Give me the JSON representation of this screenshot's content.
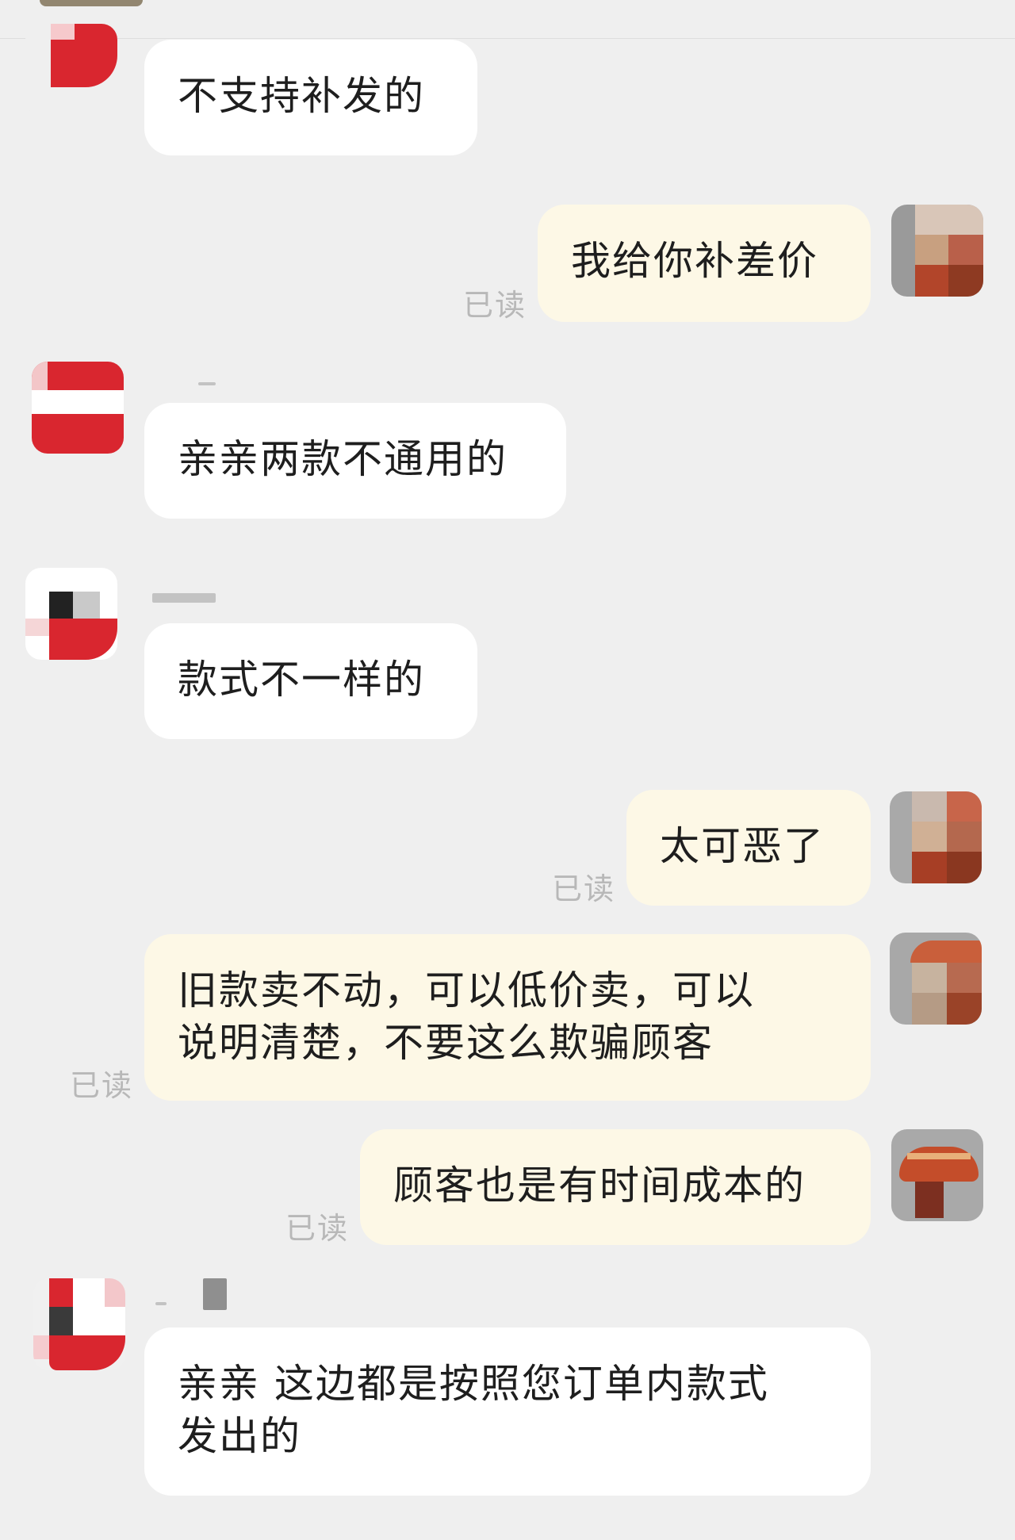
{
  "messages": [
    {
      "dir": "in",
      "text": "不支持补发的"
    },
    {
      "dir": "out",
      "text": "我给你补差价",
      "read": "已读"
    },
    {
      "dir": "in",
      "text": "亲亲两款不通用的"
    },
    {
      "dir": "in",
      "text": "款式不一样的"
    },
    {
      "dir": "out",
      "text": "太可恶了",
      "read": "已读"
    },
    {
      "dir": "out",
      "text": "旧款卖不动，可以低价卖，可以\n说明清楚，不要这么欺骗顾客",
      "read": "已读"
    },
    {
      "dir": "out",
      "text": "顾客也是有时间成本的",
      "read": "已读"
    },
    {
      "dir": "in",
      "text": "亲亲 这边都是按照您订单内款式\n发出的"
    }
  ],
  "colors": {
    "background": "#efefef",
    "incoming_bubble": "#ffffff",
    "outgoing_bubble": "#fdf8e6",
    "read_text": "#b8b8b8"
  }
}
